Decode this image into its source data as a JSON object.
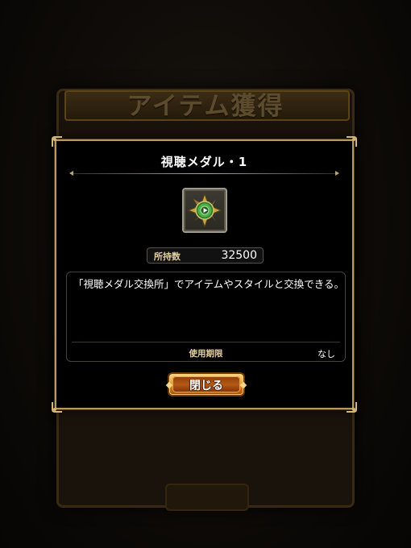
{
  "background": {
    "screen_title": "アイテム獲得"
  },
  "dialog": {
    "title": "視聴メダル・1",
    "item_icon": "green-medal-icon",
    "owned": {
      "label": "所持数",
      "value": "32500"
    },
    "description": "「視聴メダル交換所」でアイテムやスタイルと交換できる。",
    "expiry": {
      "label": "使用期限",
      "value": "なし"
    },
    "close_label": "閉じる"
  },
  "colors": {
    "frame_gold": "#b89a5e",
    "label_gold": "#e6d0a2",
    "button_orange": "#c86a14",
    "medal_green": "#3f9b3a"
  }
}
